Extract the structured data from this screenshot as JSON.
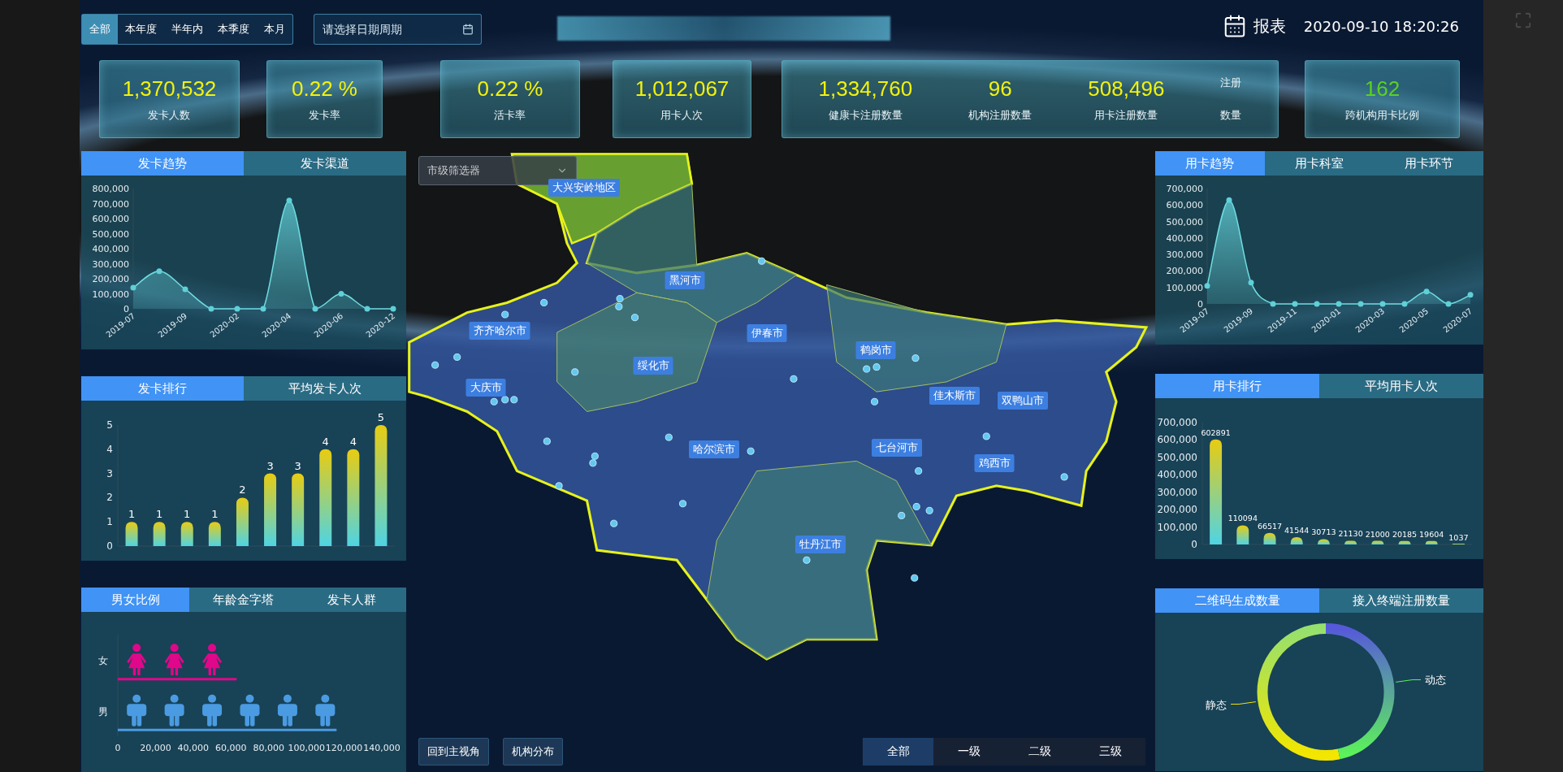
{
  "range_tabs": [
    {
      "label": "全部",
      "selected": true
    },
    {
      "label": "本年度",
      "selected": false
    },
    {
      "label": "半年内",
      "selected": false
    },
    {
      "label": "本季度",
      "selected": false
    },
    {
      "label": "本月",
      "selected": false
    }
  ],
  "date_picker": {
    "placeholder": "请选择日期周期"
  },
  "report_button": {
    "label": "报表"
  },
  "datetime": "2020-09-10 18:20:26",
  "stat_cards": [
    {
      "items": [
        {
          "value": "1,370,532",
          "label": "发卡人数",
          "color": "#f2f20c"
        }
      ]
    },
    {
      "items": [
        {
          "value": "0.22 %",
          "label": "发卡率",
          "color": "#f2f20c"
        }
      ]
    },
    {
      "items": [
        {
          "value": "0.22 %",
          "label": "活卡率",
          "color": "#f2f20c"
        }
      ]
    },
    {
      "items": [
        {
          "value": "1,012,067",
          "label": "用卡人次",
          "color": "#f2f20c"
        }
      ]
    },
    {
      "items": [
        {
          "value": "1,334,760",
          "label": "健康卡注册数量",
          "color": "#f2f20c"
        },
        {
          "value": "96",
          "label": "机构注册数量",
          "color": "#f2f20c"
        },
        {
          "value": "508,496",
          "label": "用卡注册数量",
          "color": "#f2f20c"
        }
      ],
      "side_label": [
        "注册",
        "数量"
      ]
    },
    {
      "items": [
        {
          "value": "162",
          "label": "跨机构用卡比例",
          "color": "#5ad11f"
        }
      ]
    }
  ],
  "left_panels": [
    {
      "tabs": [
        {
          "label": "发卡趋势",
          "selected": true
        },
        {
          "label": "发卡渠道",
          "selected": false
        }
      ],
      "chart_data": {
        "type": "area",
        "categories": [
          "2019-07",
          null,
          "2019-09",
          null,
          "2020-02",
          null,
          "2020-04",
          null,
          "2020-06",
          null,
          "2020-12"
        ],
        "values": [
          140000,
          250000,
          130000,
          0,
          0,
          0,
          720000,
          0,
          100000,
          0,
          0
        ],
        "ylim": [
          0,
          800000
        ],
        "yticks": [
          {
            "value": 0,
            "label": "0"
          },
          {
            "value": 100000,
            "label": "100,000"
          },
          {
            "value": 200000,
            "label": "200,000"
          },
          {
            "value": 300000,
            "label": "300,000"
          },
          {
            "value": 400000,
            "label": "400,000"
          },
          {
            "value": 500000,
            "label": "500,000"
          },
          {
            "value": 600000,
            "label": "600,000"
          },
          {
            "value": 700000,
            "label": "700,000"
          },
          {
            "value": 800000,
            "label": "800,000"
          }
        ]
      }
    },
    {
      "tabs": [
        {
          "label": "发卡排行",
          "selected": true
        },
        {
          "label": "平均发卡人次",
          "selected": false
        }
      ],
      "chart_data": {
        "type": "bar",
        "values": [
          1,
          1,
          1,
          1,
          2,
          3,
          3,
          4,
          4,
          5
        ],
        "ylim": [
          0,
          5
        ],
        "yticks": [
          0,
          1,
          2,
          3,
          4,
          5
        ],
        "data_labels": true
      }
    },
    {
      "tabs": [
        {
          "label": "男女比例",
          "selected": true
        },
        {
          "label": "年龄金字塔",
          "selected": false
        },
        {
          "label": "发卡人群",
          "selected": false
        }
      ],
      "chart_data": {
        "type": "bar",
        "orientation": "horizontal",
        "categories": [
          "女",
          "男"
        ],
        "values": [
          63000,
          116000
        ],
        "xlim": [
          0,
          140000
        ],
        "xticks": [
          {
            "value": 0,
            "label": "0"
          },
          {
            "value": 20000,
            "label": "20,000"
          },
          {
            "value": 40000,
            "label": "40,000"
          },
          {
            "value": 60000,
            "label": "60,000"
          },
          {
            "value": 80000,
            "label": "80,000"
          },
          {
            "value": 100000,
            "label": "100,000"
          },
          {
            "value": 120000,
            "label": "120,000"
          },
          {
            "value": 140000,
            "label": "140,000"
          }
        ]
      }
    }
  ],
  "map": {
    "city_filter": {
      "placeholder": "市级筛选器"
    },
    "regions": [
      {
        "label": "大兴安岭地区"
      },
      {
        "label": "黑河市"
      },
      {
        "label": "齐齐哈尔市"
      },
      {
        "label": "伊春市"
      },
      {
        "label": "绥化市"
      },
      {
        "label": "鹤岗市"
      },
      {
        "label": "大庆市"
      },
      {
        "label": "佳木斯市"
      },
      {
        "label": "双鸭山市"
      },
      {
        "label": "哈尔滨市"
      },
      {
        "label": "七台河市"
      },
      {
        "label": "鸡西市"
      },
      {
        "label": "牡丹江市"
      }
    ],
    "buttons": [
      "回到主视角",
      "机构分布"
    ],
    "level_tabs": [
      {
        "label": "全部",
        "selected": true
      },
      {
        "label": "一级",
        "selected": false
      },
      {
        "label": "二级",
        "selected": false
      },
      {
        "label": "三级",
        "selected": false
      }
    ]
  },
  "right_panels": [
    {
      "tabs": [
        {
          "label": "用卡趋势",
          "selected": true
        },
        {
          "label": "用卡科室",
          "selected": false
        },
        {
          "label": "用卡环节",
          "selected": false
        }
      ],
      "chart_data": {
        "type": "area",
        "categories": [
          "2019-07",
          null,
          "2019-09",
          null,
          "2019-11",
          null,
          "2020-01",
          null,
          "2020-03",
          null,
          "2020-05",
          null,
          "2020-07"
        ],
        "values": [
          110000,
          630000,
          130000,
          0,
          0,
          0,
          0,
          0,
          0,
          0,
          75000,
          0,
          55000
        ],
        "ylim": [
          0,
          700000
        ],
        "yticks": [
          {
            "value": 0,
            "label": "0"
          },
          {
            "value": 100000,
            "label": "100,000"
          },
          {
            "value": 200000,
            "label": "200,000"
          },
          {
            "value": 300000,
            "label": "300,000"
          },
          {
            "value": 400000,
            "label": "400,000"
          },
          {
            "value": 500000,
            "label": "500,000"
          },
          {
            "value": 600000,
            "label": "600,000"
          },
          {
            "value": 700000,
            "label": "700,000"
          }
        ]
      }
    },
    {
      "tabs": [
        {
          "label": "用卡排行",
          "selected": true
        },
        {
          "label": "平均用卡人次",
          "selected": false
        }
      ],
      "chart_data": {
        "type": "bar",
        "values": [
          602891,
          110094,
          66517,
          41544,
          30713,
          21130,
          21000,
          20185,
          19604,
          1037
        ],
        "ylim": [
          0,
          700000
        ],
        "yticks": [
          {
            "value": 0,
            "label": "0"
          },
          {
            "value": 100000,
            "label": "100,000"
          },
          {
            "value": 200000,
            "label": "200,000"
          },
          {
            "value": 300000,
            "label": "300,000"
          },
          {
            "value": 400000,
            "label": "400,000"
          },
          {
            "value": 500000,
            "label": "500,000"
          },
          {
            "value": 600000,
            "label": "600,000"
          },
          {
            "value": 700000,
            "label": "700,000"
          }
        ],
        "data_labels": true
      }
    },
    {
      "tabs": [
        {
          "label": "二维码生成数量",
          "selected": true
        },
        {
          "label": "接入终端注册数量",
          "selected": false
        }
      ],
      "donut": {
        "segments": [
          {
            "label": "静态"
          },
          {
            "label": "动态"
          }
        ]
      }
    }
  ]
}
